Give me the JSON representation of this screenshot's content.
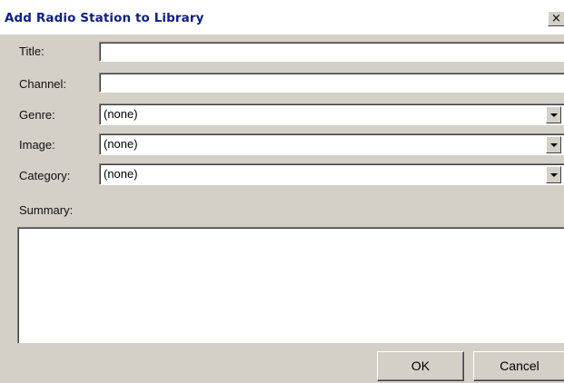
{
  "dialog": {
    "title": "Add Radio Station to Library",
    "close_glyph": "×",
    "close_icon": "close-icon"
  },
  "fields": {
    "title_label": "Title:",
    "title_value": "",
    "channel_label": "Channel:",
    "channel_value": "",
    "genre_label": "Genre:",
    "genre_value": "(none)",
    "image_label": "Image:",
    "image_value": "(none)",
    "category_label": "Category:",
    "category_value": "(none)",
    "summary_label": "Summary:",
    "summary_value": ""
  },
  "buttons": {
    "ok_label": "OK",
    "cancel_label": "Cancel"
  },
  "icons": {
    "dropdown": "chevron-down-icon"
  }
}
